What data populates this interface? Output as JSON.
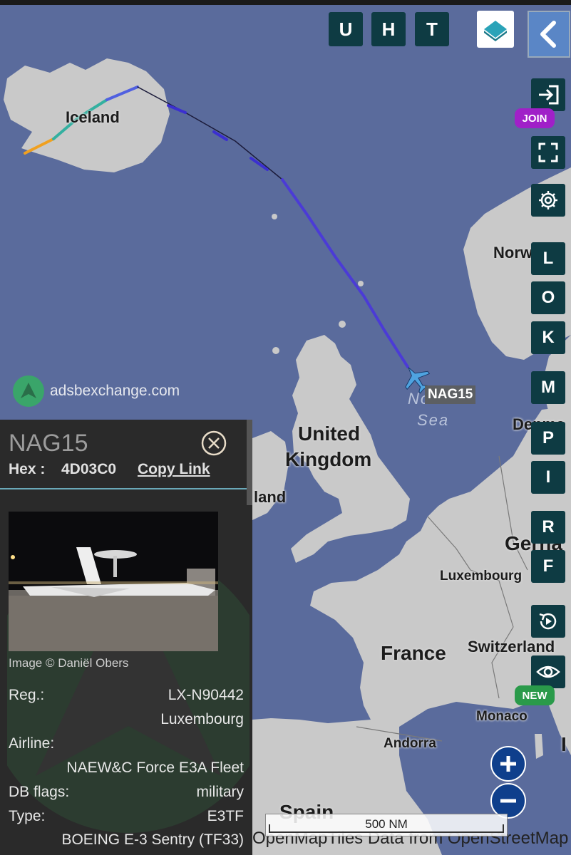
{
  "map": {
    "labels": {
      "iceland": "Iceland",
      "norway": "Norw",
      "north_sea_1": "North",
      "north_sea_2": "Sea",
      "uk_1": "United",
      "uk_2": "Kingdom",
      "ireland": "land",
      "denmark": "Denma",
      "germany": "Gerna",
      "luxembourg": "Luxembourg",
      "france": "France",
      "switzerland": "Switzerland",
      "monaco": "Monaco",
      "andorra": "Andorra",
      "spain": "Spain",
      "italy": "I"
    },
    "aircraft_label": "NAG15",
    "watermark": "adsbexchange.com",
    "scale_label": "500 NM",
    "attribution": "OpenMapTiles Data from OpenStreetMap",
    "colors": {
      "ocean": "#5a6b9c",
      "land": "#c9c9c9",
      "track": "#4b3bd6",
      "aircraft": "#4fa3e0"
    }
  },
  "toolbar": {
    "u": "U",
    "h": "H",
    "t": "T",
    "layers_icon": "layers-icon",
    "collapse_icon": "chevron-left-icon"
  },
  "side_buttons": {
    "join_icon": "login-icon",
    "join_badge": "JOIN",
    "fullscreen_icon": "fullscreen-icon",
    "settings_icon": "gear-icon",
    "l": "L",
    "o": "O",
    "k": "K",
    "m": "M",
    "p": "P",
    "i": "I",
    "r": "R",
    "f": "F",
    "replay_icon": "replay-icon",
    "eye_icon": "eye-icon",
    "new_badge": "NEW",
    "zoom_in_icon": "plus-icon",
    "zoom_out_icon": "minus-icon"
  },
  "panel": {
    "callsign": "NAG15",
    "hex_label": "Hex :",
    "hex_value": "4D03C0",
    "copy_link": "Copy Link",
    "close_icon": "close-circle-icon",
    "image_credit": "Image © Daniël Obers",
    "reg_label": "Reg.:",
    "reg_value": "LX-N90442",
    "country": "Luxembourg",
    "airline_label": "Airline:",
    "airline_value": "NAEW&C Force E3A Fleet",
    "db_flags_label": "DB flags:",
    "db_flags_value": "military",
    "type_label": "Type:",
    "type_value": "E3TF",
    "type_desc": "BOEING E-3 Sentry (TF33)"
  }
}
